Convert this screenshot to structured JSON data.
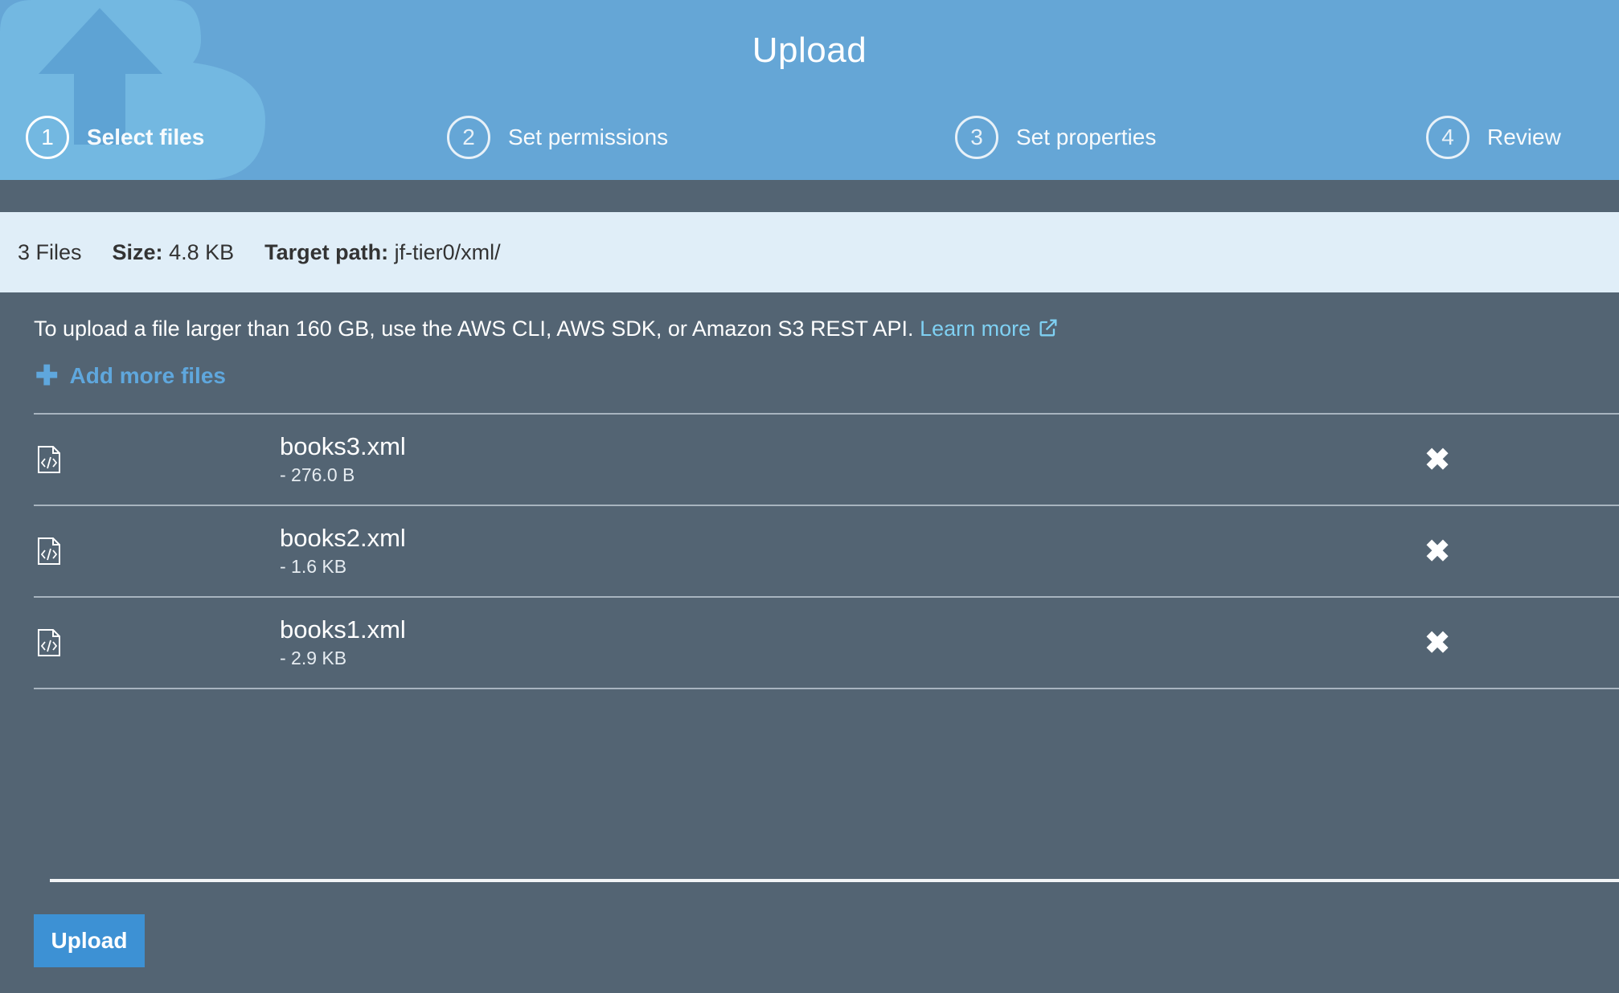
{
  "header": {
    "title": "Upload",
    "steps": [
      {
        "number": "1",
        "label": "Select files",
        "active": true
      },
      {
        "number": "2",
        "label": "Set permissions",
        "active": false
      },
      {
        "number": "3",
        "label": "Set properties",
        "active": false
      },
      {
        "number": "4",
        "label": "Review",
        "active": false
      }
    ]
  },
  "summary": {
    "files_count": "3 Files",
    "size_label": "Size:",
    "size_value": "4.8 KB",
    "target_label": "Target path:",
    "target_value": "jf-tier0/xml/"
  },
  "notice": {
    "text": "To upload a file larger than 160 GB, use the AWS CLI, AWS SDK, or Amazon S3 REST API.",
    "link_label": "Learn more",
    "link_icon": "external-link-icon"
  },
  "add_more": {
    "label": "Add more files",
    "icon": "plus-icon"
  },
  "files": [
    {
      "name": "books3.xml",
      "size": "- 276.0 B",
      "icon": "xml-file-icon"
    },
    {
      "name": "books2.xml",
      "size": "- 1.6 KB",
      "icon": "xml-file-icon"
    },
    {
      "name": "books1.xml",
      "size": "- 2.9 KB",
      "icon": "xml-file-icon"
    }
  ],
  "actions": {
    "upload_label": "Upload"
  },
  "colors": {
    "header_bg": "#65a6d6",
    "panel_bg": "#536473",
    "summary_bg": "#e0eef8",
    "link": "#7fd0f2",
    "accent_button": "#3d91d4"
  }
}
